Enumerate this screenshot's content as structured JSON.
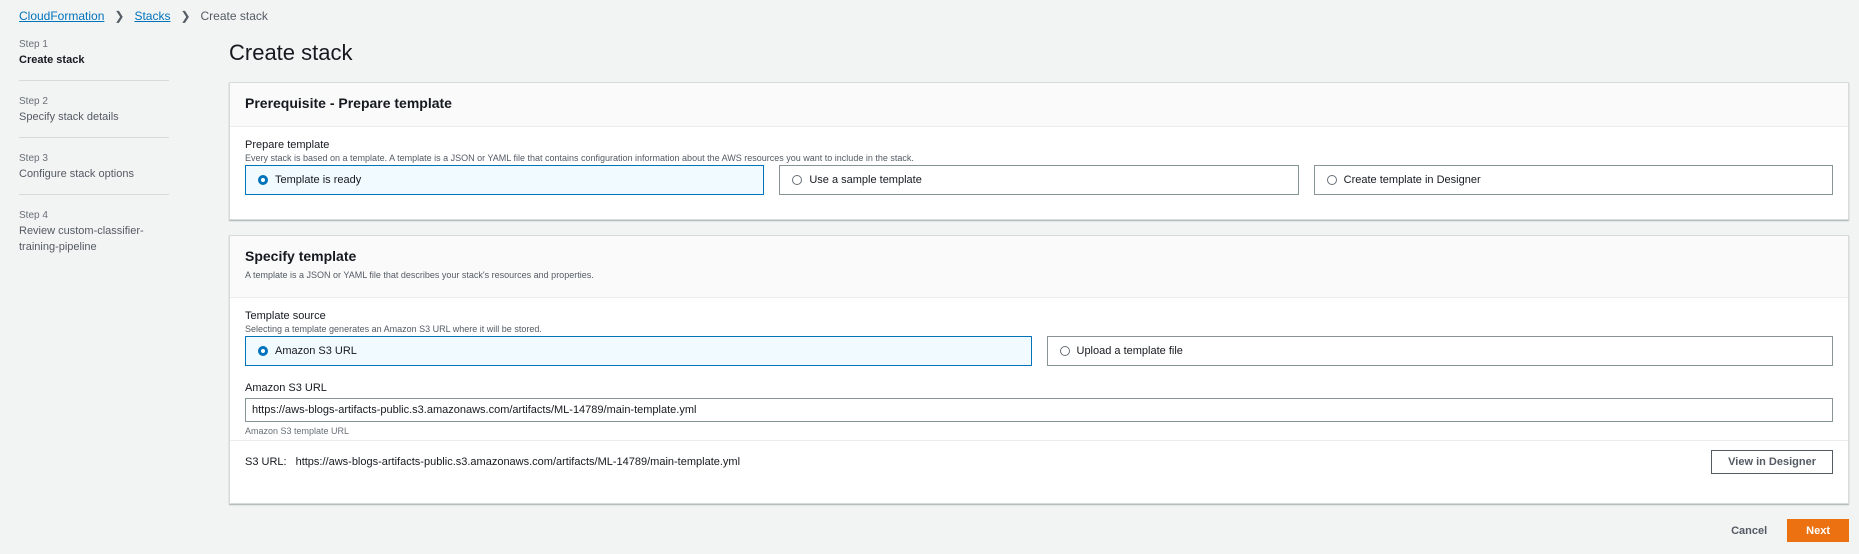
{
  "breadcrumb": {
    "root": "CloudFormation",
    "stacks": "Stacks",
    "current": "Create stack"
  },
  "steps": [
    {
      "num": "Step 1",
      "title": "Create stack"
    },
    {
      "num": "Step 2",
      "title": "Specify stack details"
    },
    {
      "num": "Step 3",
      "title": "Configure stack options"
    },
    {
      "num": "Step 4",
      "title": "Review custom-classifier-training-pipeline"
    }
  ],
  "page_title": "Create stack",
  "prerequisite": {
    "heading": "Prerequisite - Prepare template",
    "label": "Prepare template",
    "description": "Every stack is based on a template. A template is a JSON or YAML file that contains configuration information about the AWS resources you want to include in the stack.",
    "options": [
      {
        "label": "Template is ready",
        "selected": true
      },
      {
        "label": "Use a sample template",
        "selected": false
      },
      {
        "label": "Create template in Designer",
        "selected": false
      }
    ]
  },
  "specify": {
    "heading": "Specify template",
    "description": "A template is a JSON or YAML file that describes your stack's resources and properties.",
    "source_label": "Template source",
    "source_description": "Selecting a template generates an Amazon S3 URL where it will be stored.",
    "source_options": [
      {
        "label": "Amazon S3 URL",
        "selected": true
      },
      {
        "label": "Upload a template file",
        "selected": false
      }
    ],
    "url_label": "Amazon S3 URL",
    "url_value": "https://aws-blogs-artifacts-public.s3.amazonaws.com/artifacts/ML-14789/main-template.yml",
    "url_constraint": "Amazon S3 template URL",
    "s3_key": "S3 URL:",
    "s3_value": "https://aws-blogs-artifacts-public.s3.amazonaws.com/artifacts/ML-14789/main-template.yml",
    "designer_button": "View in Designer"
  },
  "actions": {
    "cancel": "Cancel",
    "next": "Next"
  },
  "colors": {
    "link": "#0073bb",
    "primary": "#ec7211",
    "background": "#f2f3f3"
  }
}
